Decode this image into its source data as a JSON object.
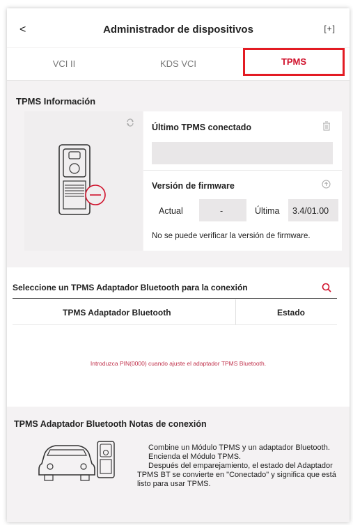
{
  "header": {
    "back_glyph": "<",
    "title": "Administrador de dispositivos",
    "expand_glyph": "[+]"
  },
  "tabs": [
    {
      "label": "VCI II",
      "active": false
    },
    {
      "label": "KDS VCI",
      "active": false
    },
    {
      "label": "TPMS",
      "active": true
    }
  ],
  "tpms_info": {
    "title": "TPMS Información",
    "last_connected_label": "Último TPMS conectado",
    "last_connected_value": "",
    "firmware_label": "Versión de firmware",
    "current_label": "Actual",
    "current_value": "-",
    "latest_label": "Última",
    "latest_value": "3.4/01.00",
    "verify_message": "No se puede verificar la versión de firmware."
  },
  "bluetooth": {
    "title": "Seleccione un TPMS Adaptador Bluetooth para la conexión",
    "col_adapter": "TPMS Adaptador Bluetooth",
    "col_status": "Estado",
    "pin_message": "Introduzca PIN(0000) cuando ajuste el adaptador TPMS Bluetooth."
  },
  "notes": {
    "title": "TPMS Adaptador Bluetooth Notas de conexión",
    "lines": [
      "Combine un Módulo TPMS y un adaptador Bluetooth.",
      "Encienda el Módulo TPMS.",
      "Después del emparejamiento, el estado del Adaptador TPMS BT se convierte en \"Conectado\" y significa que está listo para usar TPMS."
    ]
  },
  "colors": {
    "accent_red": "#d0102a",
    "highlight_red": "#e31b23"
  }
}
